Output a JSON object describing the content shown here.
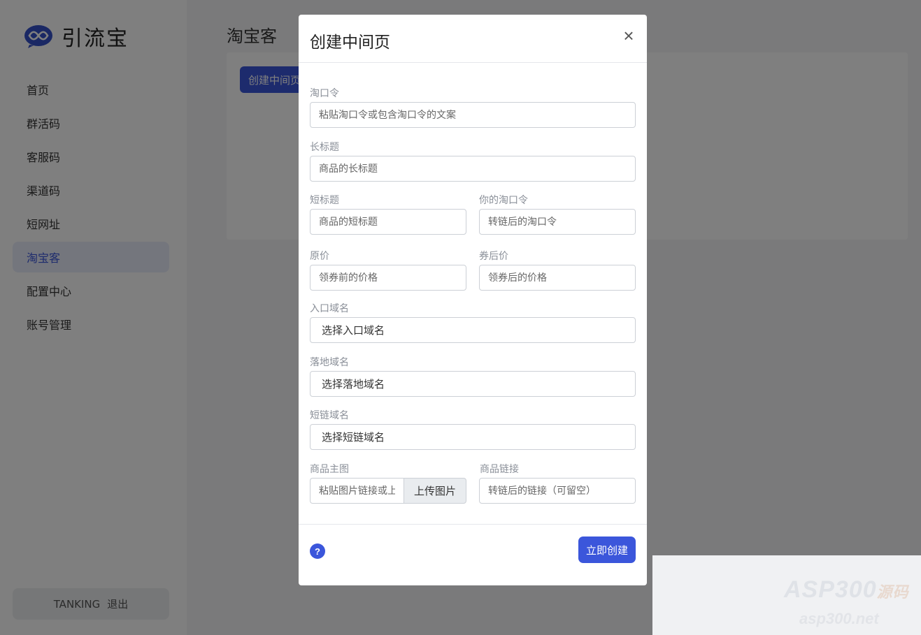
{
  "app": {
    "name": "引流宝"
  },
  "sidebar": {
    "items": [
      {
        "label": "首页"
      },
      {
        "label": "群活码"
      },
      {
        "label": "客服码"
      },
      {
        "label": "渠道码"
      },
      {
        "label": "短网址"
      },
      {
        "label": "淘宝客",
        "active": true
      },
      {
        "label": "配置中心"
      },
      {
        "label": "账号管理"
      }
    ],
    "account": {
      "username": "TANKING",
      "logout_label": "退出"
    }
  },
  "main": {
    "title": "淘宝客",
    "create_button_label": "创建中间页"
  },
  "modal": {
    "title": "创建中间页",
    "close_icon": "×",
    "fields": {
      "tkl": {
        "label": "淘口令",
        "placeholder": "粘贴淘口令或包含淘口令的文案"
      },
      "long_title": {
        "label": "长标题",
        "placeholder": "商品的长标题"
      },
      "short_title": {
        "label": "短标题",
        "placeholder": "商品的短标题"
      },
      "your_tkl": {
        "label": "你的淘口令",
        "placeholder": "转链后的淘口令"
      },
      "original_price": {
        "label": "原价",
        "placeholder": "领券前的价格"
      },
      "coupon_price": {
        "label": "券后价",
        "placeholder": "领券后的价格"
      },
      "entry_domain": {
        "label": "入口域名",
        "value": "选择入口域名"
      },
      "landing_domain": {
        "label": "落地域名",
        "value": "选择落地域名"
      },
      "short_domain": {
        "label": "短链域名",
        "value": "选择短链域名"
      },
      "main_image": {
        "label": "商品主图",
        "placeholder": "粘贴图片链接或上传",
        "upload_label": "上传图片"
      },
      "product_link": {
        "label": "商品链接",
        "placeholder": "转链后的链接（可留空）"
      }
    },
    "help_icon": "?",
    "submit_label": "立即创建"
  },
  "watermark": {
    "line1": "ASP300",
    "line1_cn": "源码",
    "line2": "asp300.net"
  },
  "colors": {
    "accent": "#3b56db",
    "active_bg": "#e9ecfb"
  }
}
